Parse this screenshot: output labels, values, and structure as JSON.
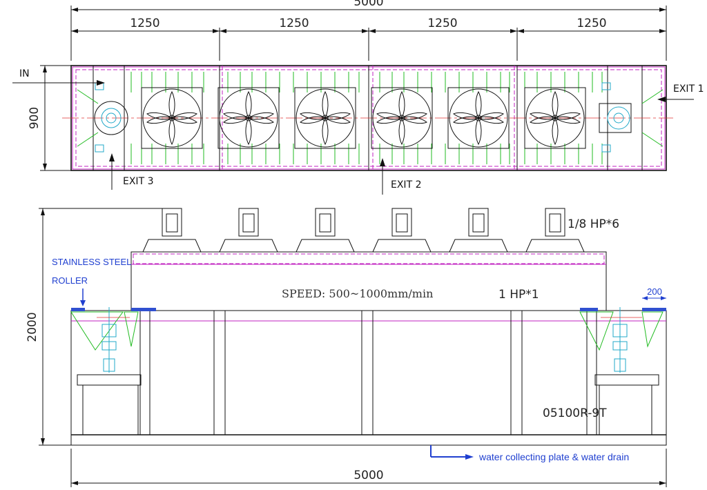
{
  "top_view": {
    "overall_dim": "5000",
    "section_dims": [
      "1250",
      "1250",
      "1250",
      "1250"
    ],
    "height_dim": "900",
    "in_label": "IN",
    "exit1_label": "EXIT 1",
    "exit2_label": "EXIT 2",
    "exit3_label": "EXIT 3"
  },
  "side_view": {
    "motor_label": "1/8 HP*6",
    "roller_label_line1": "STAINLESS STEEL",
    "roller_label_line2": "ROLLER",
    "speed_label": "SPEED:  500~1000mm/min",
    "drive_label": "1 HP*1",
    "roller_dim": "200",
    "height_dim": "2000",
    "model_label": "05100R-9T",
    "drain_label": "water collecting plate & water drain",
    "overall_dim": "5000"
  },
  "colors": {
    "outline": "#111111",
    "frame": "#c020c0",
    "rollers": "#22bb22",
    "centerline": "#e03030",
    "fittings": "#20a8c8",
    "annotation": "#1f3fd0"
  }
}
